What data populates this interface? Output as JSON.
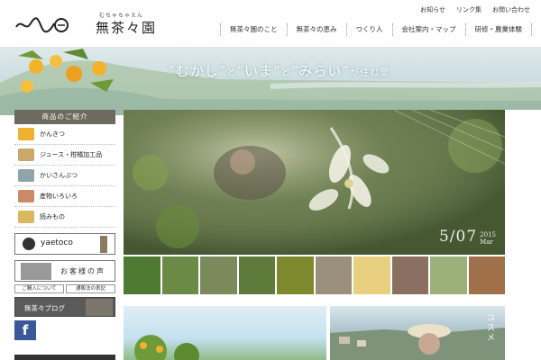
{
  "header": {
    "logo_script": "むちゃちゃえん",
    "logo_name": "無茶々園",
    "utility": [
      "お知らせ",
      "リンク集",
      "お問い合わせ"
    ],
    "nav": [
      "無茶々園のこと",
      "無茶々の恵み",
      "つくり人",
      "会社案内・マップ",
      "研修・農業体験"
    ]
  },
  "hero": {
    "tagline_parts": [
      "“むかし”",
      "と",
      "“いま”",
      "と",
      "“みらい”",
      "が住む里"
    ]
  },
  "sidebar": {
    "heading": "商品のご紹介",
    "items": [
      {
        "label": "かんきつ",
        "thumb_color": "#f0b030"
      },
      {
        "label": "ジュース・柑橘加工品",
        "thumb_color": "#c9a86a"
      },
      {
        "label": "かいさんぶつ",
        "thumb_color": "#8fa3a8"
      },
      {
        "label": "産物いろいろ",
        "thumb_color": "#c98a6a"
      },
      {
        "label": "読みもの",
        "thumb_color": "#d9b860"
      }
    ],
    "banners": {
      "yaetoco": "yaetoco",
      "voice": "お客様の声",
      "order_info": "ご購入について",
      "law_notice": "通販法の表記",
      "blog": "無茶々ブログ",
      "facebook": "f"
    }
  },
  "slideshow": {
    "date_big": "5/07",
    "date_year": "2015",
    "date_month": "Mar"
  },
  "thumbs": [
    {
      "name": "thumb-grass",
      "color": "#4f7a32"
    },
    {
      "name": "thumb-flower",
      "color": "#6a8a45"
    },
    {
      "name": "thumb-farmer",
      "color": "#7a8a5a"
    },
    {
      "name": "thumb-trees",
      "color": "#5e7b3c"
    },
    {
      "name": "thumb-citrus",
      "color": "#7c8a2d"
    },
    {
      "name": "thumb-conveyor",
      "color": "#9a8f7a"
    },
    {
      "name": "thumb-fruit",
      "color": "#e8d080"
    },
    {
      "name": "thumb-people",
      "color": "#8a7060"
    },
    {
      "name": "thumb-plant",
      "color": "#9cb07a"
    },
    {
      "name": "thumb-shop",
      "color": "#a0704a"
    }
  ],
  "features": {
    "cosme_label": "コスメ"
  },
  "colors": {
    "sidebar_head": "#6e6a5f",
    "facebook": "#3b5998"
  }
}
